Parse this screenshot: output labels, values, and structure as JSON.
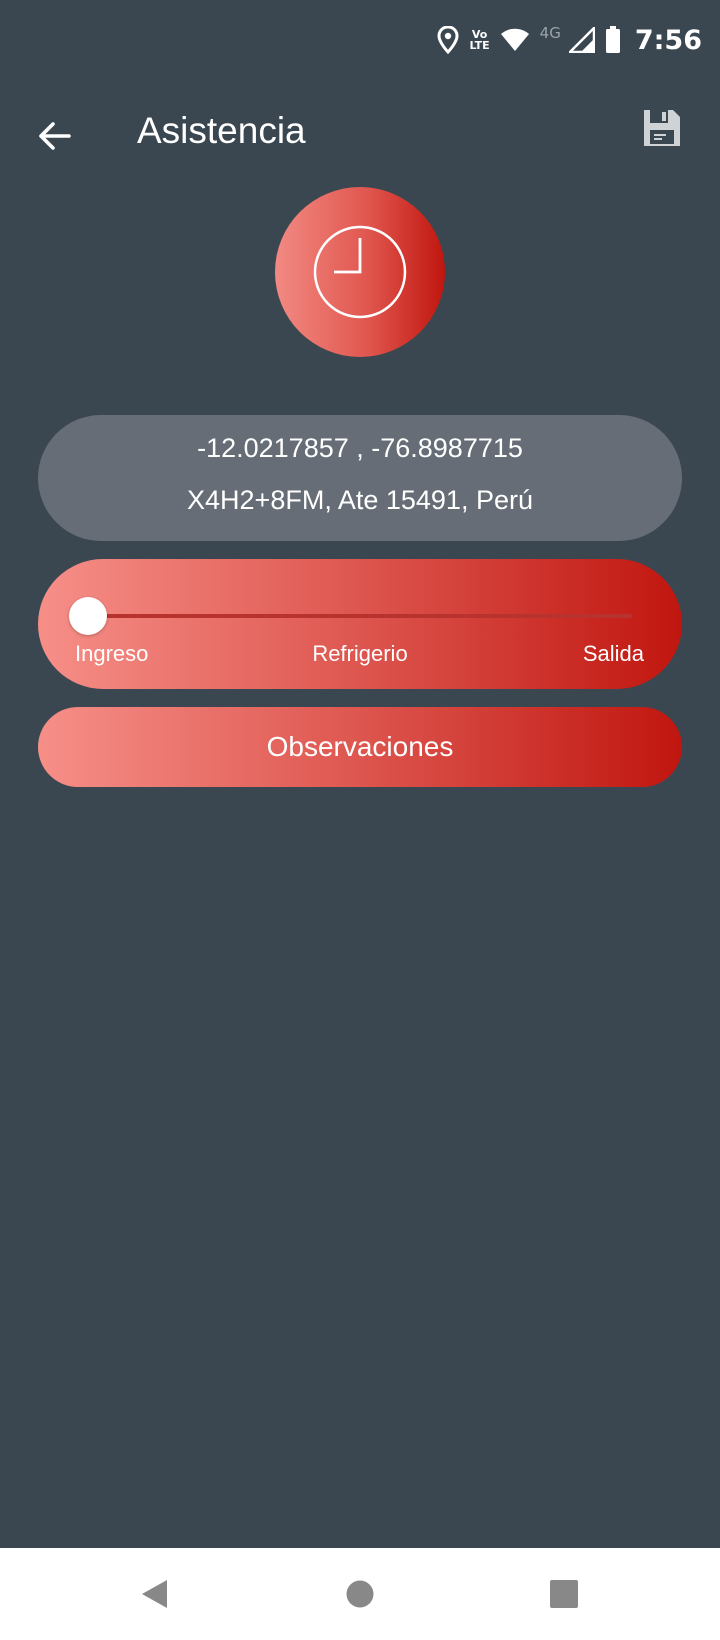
{
  "status_bar": {
    "time": "7:56",
    "network": "4G",
    "volte_top": "Vo",
    "volte_bottom": "LTE",
    "icons": [
      "location-icon",
      "volte-icon",
      "wifi-icon",
      "signal-icon",
      "battery-icon"
    ]
  },
  "app_bar": {
    "title": "Asistencia",
    "back_icon": "arrow-left-icon",
    "save_icon": "floppy-disk-icon"
  },
  "clock": {
    "icon": "clock-icon"
  },
  "location": {
    "coordinates": "-12.0217857 , -76.8987715",
    "address": "X4H2+8FM, Ate 15491, Perú"
  },
  "attendance_slider": {
    "stops": [
      "Ingreso",
      "Refrigerio",
      "Salida"
    ],
    "selected": "Ingreso",
    "selected_index": 0
  },
  "observaciones_label": "Observaciones",
  "nav_bar": {
    "icons": [
      "back-triangle-icon",
      "home-circle-icon",
      "recents-square-icon"
    ]
  },
  "colors": {
    "background": "#3a4750",
    "card_gray": "#666d76",
    "accent_light": "#f68f88",
    "accent_dark": "#c0160f"
  }
}
